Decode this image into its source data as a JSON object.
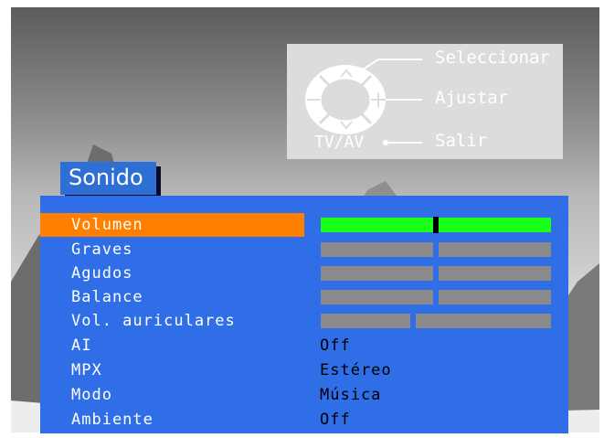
{
  "colors": {
    "menu_bg": "#2f6ee6",
    "title_bg": "#2e6fd6",
    "highlight": "#ff7f00",
    "bar_active": "#19ff19",
    "bar_inactive": "#8b8b8b",
    "remote_panel": "#dcdcdc"
  },
  "remote": {
    "up_icon": "chevron-up-icon",
    "down_icon": "chevron-down-icon",
    "minus_icon": "minus-icon",
    "plus_icon": "plus-icon",
    "select_label": "Seleccionar",
    "adjust_label": "Ajustar",
    "exit_label": "Salir",
    "source_label": "TV/AV"
  },
  "menu": {
    "title": "Sonido",
    "items": [
      {
        "label": "Volumen",
        "type": "slider",
        "level": 0.5,
        "selected": true
      },
      {
        "label": "Graves",
        "type": "slider",
        "level": 0.5
      },
      {
        "label": "Agudos",
        "type": "slider",
        "level": 0.5
      },
      {
        "label": "Balance",
        "type": "slider",
        "level": 0.5
      },
      {
        "label": "Vol. auriculares",
        "type": "slider",
        "level": 0.4
      },
      {
        "label": "AI",
        "type": "value",
        "value": "Off"
      },
      {
        "label": "MPX",
        "type": "value",
        "value": "Estéreo"
      },
      {
        "label": "Modo",
        "type": "value",
        "value": "Música"
      },
      {
        "label": "Ambiente",
        "type": "value",
        "value": "Off"
      }
    ]
  }
}
